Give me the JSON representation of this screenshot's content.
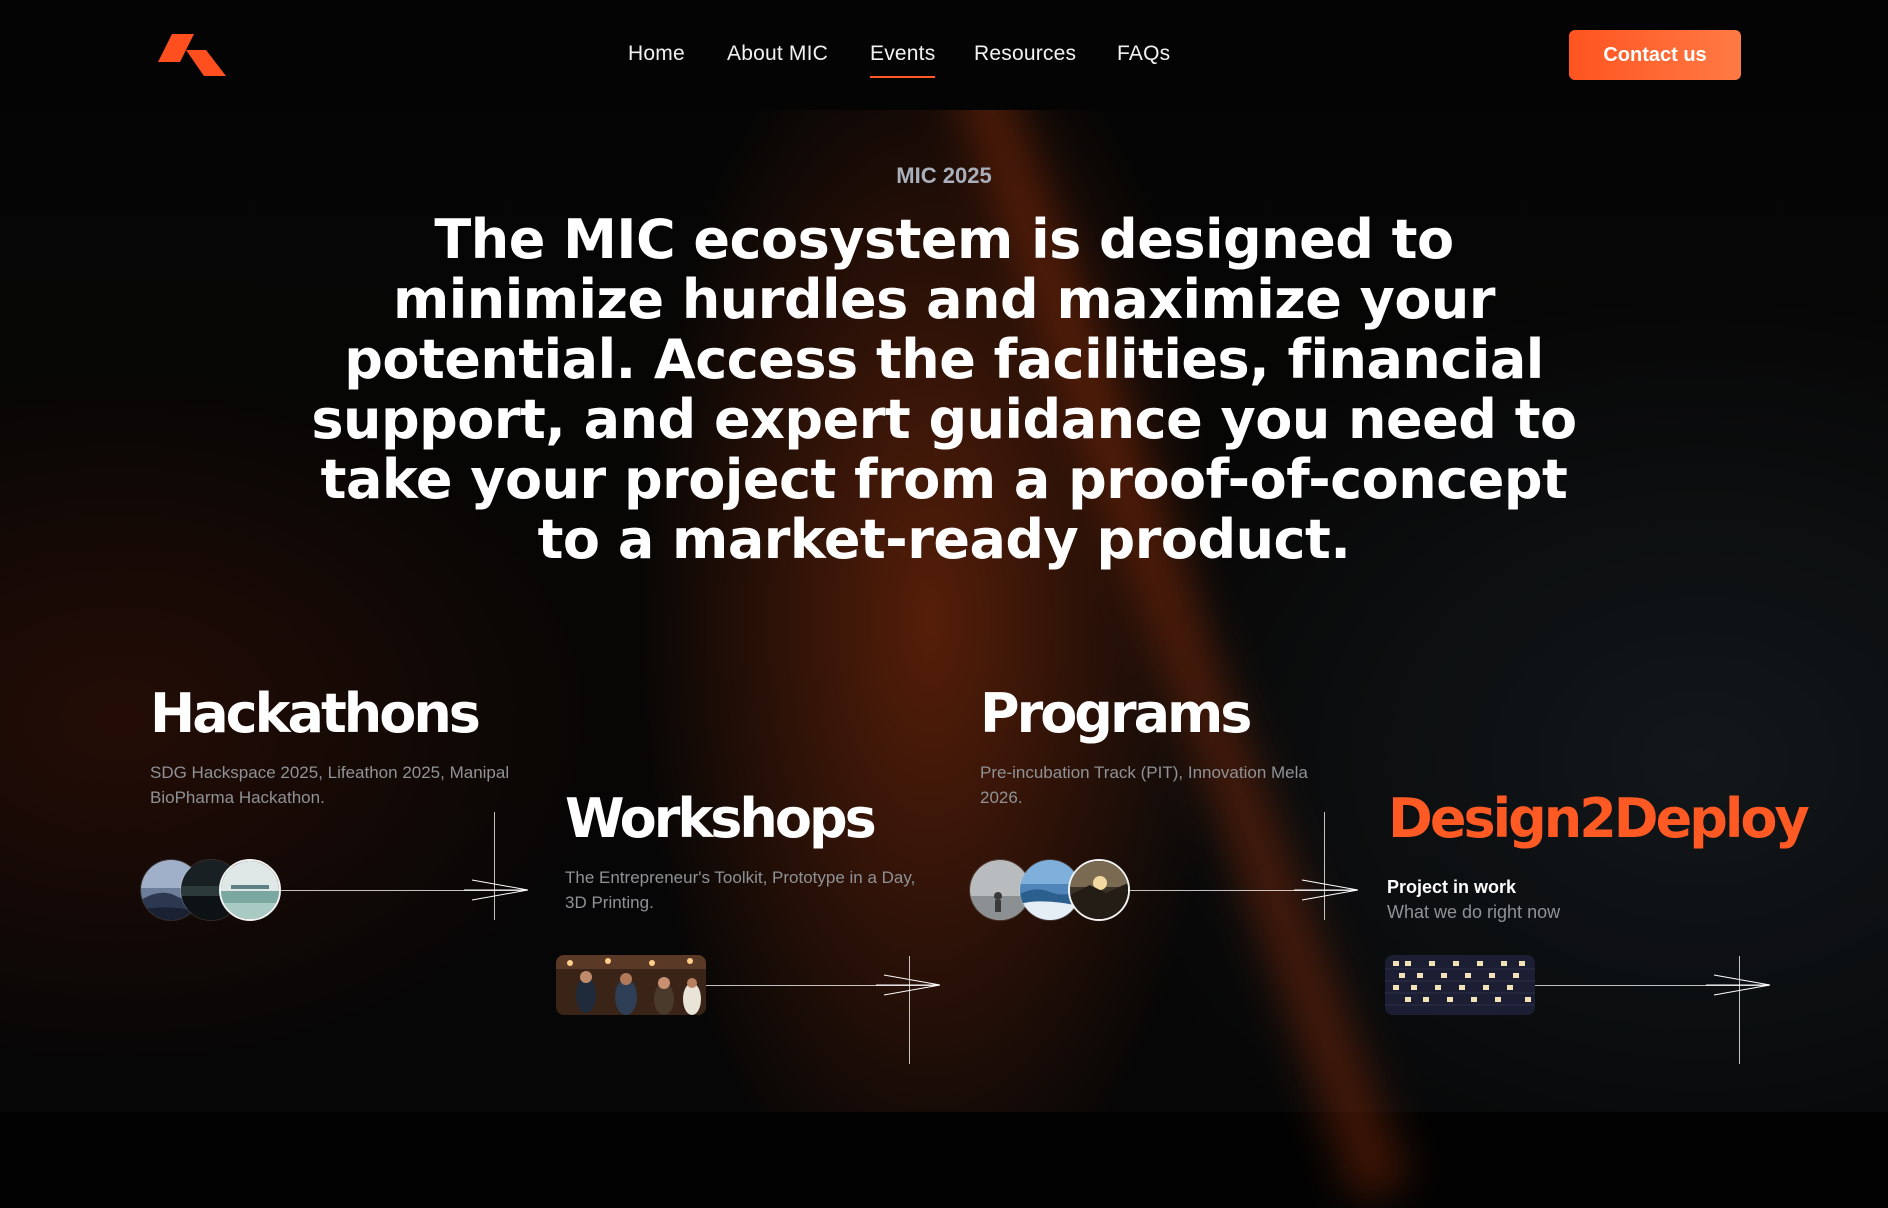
{
  "colors": {
    "accent": "#ff5a24",
    "background": "#020202",
    "muted_text": "#8f9296",
    "eyebrow": "#a9b0bb"
  },
  "header": {
    "logo_icon": "mic-logo-icon",
    "nav": [
      {
        "label": "Home",
        "active": false
      },
      {
        "label": "About MIC",
        "active": false
      },
      {
        "label": "Events",
        "active": true
      },
      {
        "label": "Resources",
        "active": false
      },
      {
        "label": "FAQs",
        "active": false
      }
    ],
    "contact_label": "Contact us"
  },
  "hero": {
    "eyebrow": "MIC 2025",
    "title": "The MIC ecosystem is designed to minimize hurdles and maximize your potential. Access the facilities, financial support, and expert guidance you need to take your project from a proof-of-concept to a market-ready product."
  },
  "cards": {
    "hackathons": {
      "title": "Hackathons",
      "description": "SDG Hackspace 2025, Lifeathon 2025, Manipal BioPharma Hackathon."
    },
    "workshops": {
      "title": "Workshops",
      "description": "The Entrepreneur's Toolkit, Prototype in a Day, 3D Printing."
    },
    "programs": {
      "title": "Programs",
      "description": "Pre-incubation Track (PIT), Innovation Mela 2026."
    },
    "design2deploy": {
      "title": "Design2Deploy",
      "subtitle": "Project in work",
      "note": "What we do right now"
    }
  }
}
